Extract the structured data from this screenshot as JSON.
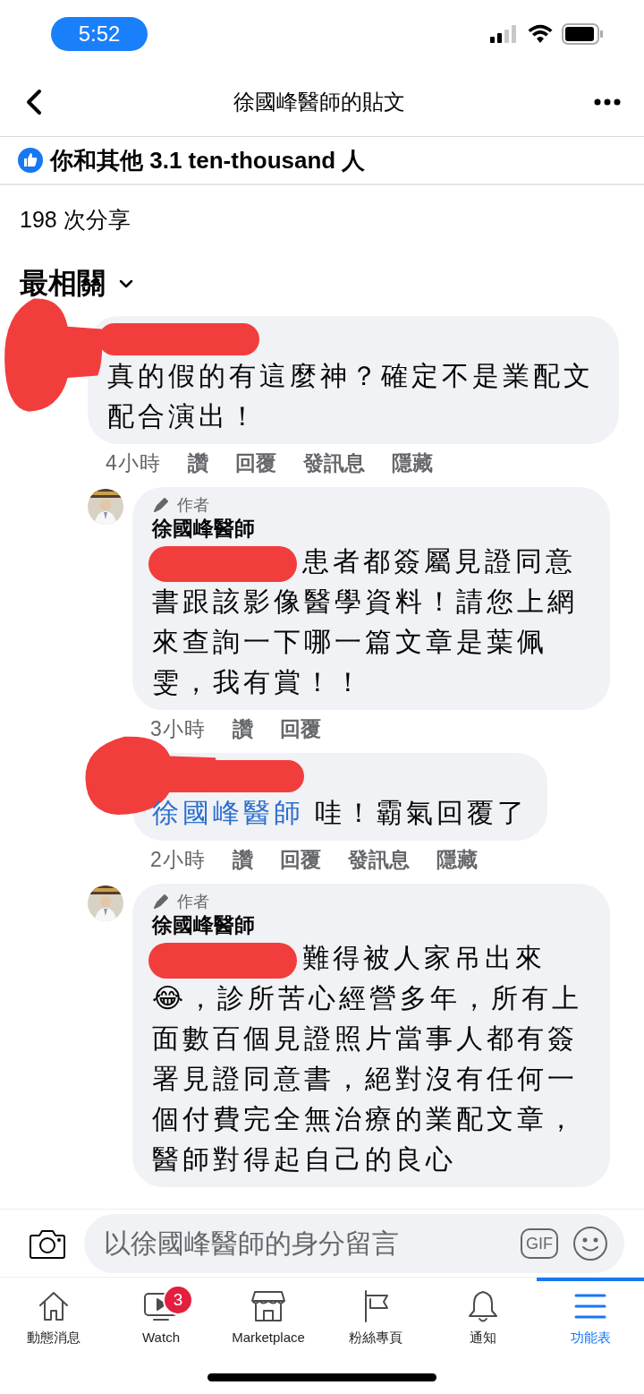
{
  "status_bar": {
    "time": "5:52"
  },
  "header": {
    "title": "徐國峰醫師的貼文"
  },
  "reactions": {
    "text": "你和其他 3.1 ten-thousand 人"
  },
  "shares": "198 次分享",
  "sort": {
    "label": "最相關"
  },
  "comments": [
    {
      "kind": "top",
      "redacted": true,
      "body": "真的假的有這麼神？確定不是業配文配合演出！",
      "time": "4小時",
      "actions": [
        "讚",
        "回覆",
        "發訊息",
        "隱藏"
      ]
    },
    {
      "kind": "reply",
      "redacted": false,
      "badge": "作者",
      "author": "徐國峰醫師",
      "mention_redacted": true,
      "body": "患者都簽屬見證同意書跟該影像醫學資料！請您上網來查詢一下哪一篇文章是葉佩雯，我有賞！！",
      "time": "3小時",
      "actions": [
        "讚",
        "回覆"
      ]
    },
    {
      "kind": "reply",
      "redacted": true,
      "mention": "徐國峰醫師",
      "body": "哇！霸氣回覆了",
      "time": "2小時",
      "actions": [
        "讚",
        "回覆",
        "發訊息",
        "隱藏"
      ]
    },
    {
      "kind": "reply",
      "redacted": false,
      "badge": "作者",
      "author": "徐國峰醫師",
      "mention_redacted": true,
      "body": "難得被人家吊出來😂，診所苦心經營多年，所有上面數百個見證照片當事人都有簽署見證同意書，絕對沒有任何一個付費完全無治療的業配文章，醫師對得起自己的良心"
    }
  ],
  "composer": {
    "placeholder": "以徐國峰醫師的身分留言",
    "gif": "GIF"
  },
  "tab_bar": [
    {
      "label": "動態消息",
      "selected": false
    },
    {
      "label": "Watch",
      "selected": false,
      "badge": "3"
    },
    {
      "label": "Marketplace",
      "selected": false
    },
    {
      "label": "粉絲專頁",
      "selected": false
    },
    {
      "label": "通知",
      "selected": false
    },
    {
      "label": "功能表",
      "selected": true
    }
  ]
}
